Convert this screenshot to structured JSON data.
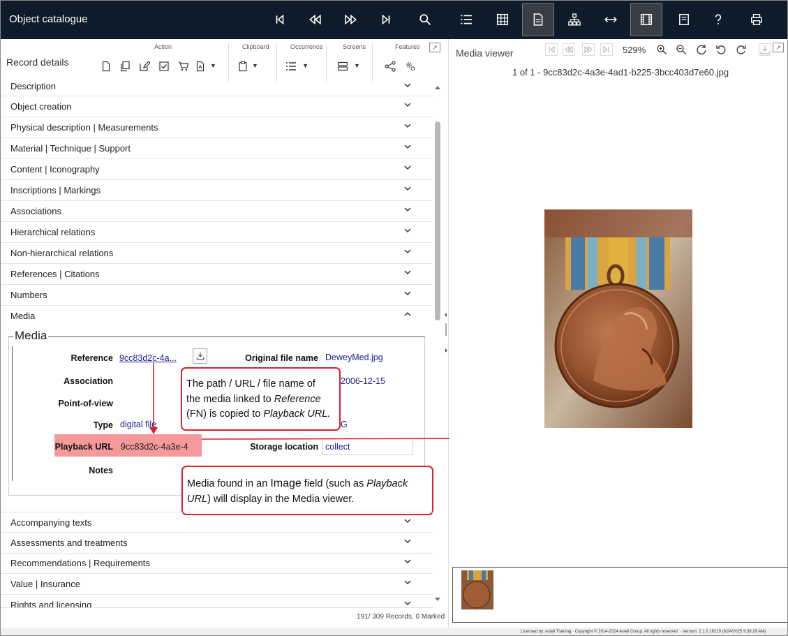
{
  "app": {
    "title": "Object catalogue"
  },
  "record": {
    "title": "Record details",
    "groups": {
      "action": "Action",
      "clipboard": "Clipboard",
      "occurrence": "Occurrence",
      "screens": "Screens",
      "features": "Features"
    },
    "sections_top": [
      "Description",
      "Object creation",
      "Physical description | Measurements",
      "Material | Technique | Support",
      "Content | Iconography",
      "Inscriptions | Markings",
      "Associations",
      "Hierarchical relations",
      "Non-hierarchical relations",
      "References | Citations",
      "Numbers",
      "Media"
    ],
    "media": {
      "legend": "Media",
      "reference_label": "Reference",
      "reference_value": "9cc83d2c-4a...",
      "original_file_name_label": "Original file name",
      "original_file_name_value": "DeweyMed.jpg",
      "association_label": "Association",
      "date_value": "2006-12-15",
      "point_of_view_label": "Point-of-view",
      "type_label": "Type",
      "type_value": "digital file",
      "type_value_right": "G",
      "playback_url_label": "Playback URL",
      "playback_url_value": "9cc83d2c-4a3e-4",
      "storage_location_label": "Storage location",
      "storage_location_value": "collect",
      "notes_label": "Notes"
    },
    "sections_bottom": [
      "Accompanying texts",
      "Assessments and treatments",
      "Recommendations | Requirements",
      "Value | Insurance",
      "Rights and licensing"
    ],
    "status": "191/ 309 Records, 0 Marked"
  },
  "callouts": {
    "one": {
      "line1": "The path / URL / file name of",
      "line2a": "the media linked to ",
      "line2b": "Reference",
      "line3a": "(FN) is copied to ",
      "line3b": "Playback URL."
    },
    "two": {
      "line1a": "Media found in an ",
      "line1b": "Image",
      "line1c": " field (such as ",
      "line1d": "Playback",
      "line2a": "URL",
      "line2b": ") will display in the Media viewer."
    }
  },
  "viewer": {
    "title": "Media viewer",
    "zoom": "529%",
    "counter": "1 of 1 - 9cc83d2c-4a3e-4ad1-b225-3bcc403d7e60.jpg"
  },
  "footer": {
    "text": "Licensed by: Axiell Training · Copyright © 2014-2024 Axiell Group. All rights reserved. · Version: 2.1.0.16219 (6/24/2025 9:39:29 AM)"
  },
  "colors": {
    "topbar": "#0d1b2a",
    "highlight": "#f59a9a",
    "callout_border": "#d9202c",
    "link": "#1a1a8a"
  }
}
